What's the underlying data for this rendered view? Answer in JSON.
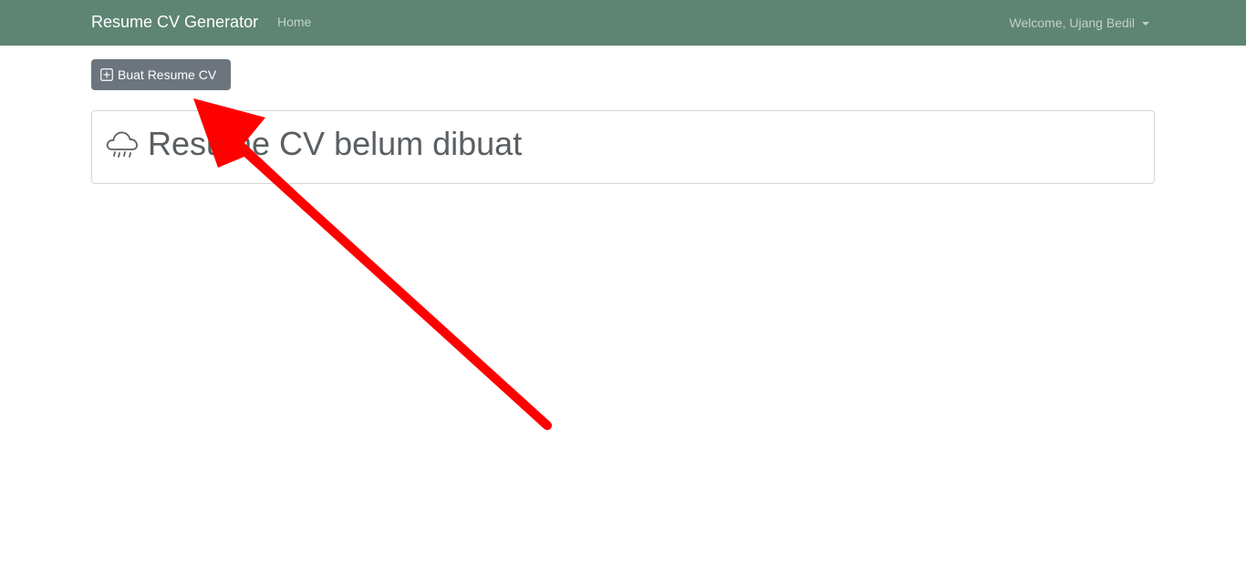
{
  "navbar": {
    "brand": "Resume CV Generator",
    "home_label": "Home",
    "user_menu_label": "Welcome, Ujang Bedil",
    "background_color": "#5e8474"
  },
  "toolbar": {
    "create_button_label": "Buat Resume CV",
    "create_button_icon": "plus-square-icon",
    "button_color": "#6c757d"
  },
  "empty_state": {
    "icon": "cloud-rain-icon",
    "message": "Resume CV belum dibuat"
  },
  "annotation": {
    "type": "red-arrow",
    "color": "#ff0000",
    "points_to": "create-resume-button"
  }
}
